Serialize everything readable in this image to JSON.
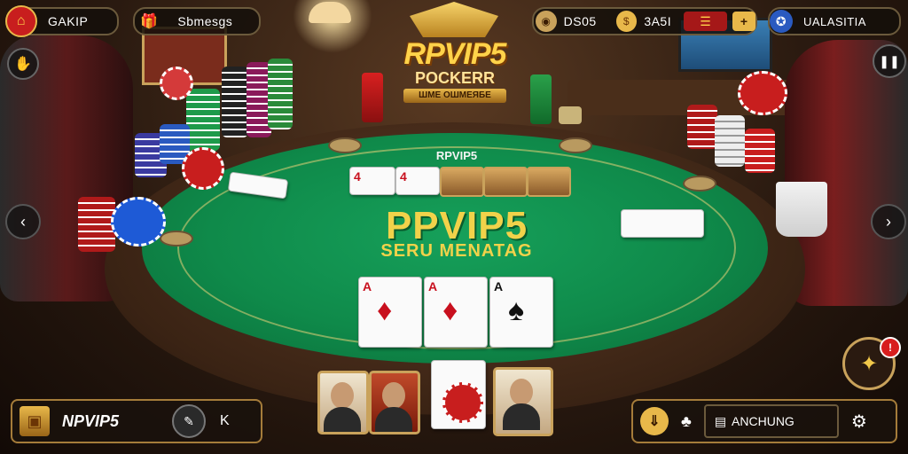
{
  "top_bar": {
    "home_label": "GAKIP",
    "profile_label": "Sbmesgs",
    "chips_value": "DS05",
    "coins_value": "3A5I",
    "add_icon": "plus-icon",
    "vip_label": "UALASITIA"
  },
  "logo": {
    "main": "RPVIP5",
    "sub": "POCKERR",
    "ribbon": "ШМЕ ОШМЕЯБЕ"
  },
  "table": {
    "small_label": "RPVIP5",
    "big_title": "PPVIP5",
    "tagline": "SERU MENATAG"
  },
  "community_cards": [
    {
      "rank": "A",
      "suit": "♦",
      "color": "red"
    },
    {
      "rank": "A",
      "suit": "♦",
      "color": "red"
    },
    {
      "rank": "A",
      "suit": "♠",
      "color": "black"
    }
  ],
  "bottom_left": {
    "label": "NPVIP5",
    "close": "K"
  },
  "bottom_right": {
    "status": "ANCHUNG"
  },
  "badge": {
    "count": "!"
  },
  "colors": {
    "felt": "#0f8a4a",
    "accent_gold": "#f1d24a",
    "rail": "#3a2314"
  }
}
